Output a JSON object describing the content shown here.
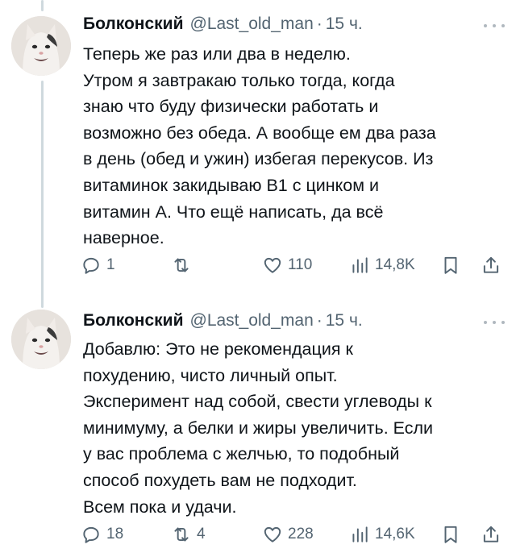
{
  "tweets": [
    {
      "author_name": "Болконский",
      "handle": "@Last_old_man",
      "separator": "·",
      "time": "15 ч.",
      "lines": [
        "Теперь же раз или два в неделю.",
        "Утром я завтракаю только тогда, когда",
        "знаю что буду физически работать и",
        "возможно без обеда. А вообще ем два раза",
        "в день (обед и ужин) избегая перекусов. Из",
        "витаминок закидываю B1 с цинком и",
        "витамин А. Что ещё написать, да всё",
        "наверное."
      ],
      "replies": "1",
      "retweets": "",
      "likes": "110",
      "views": "14,8K"
    },
    {
      "author_name": "Болконский",
      "handle": "@Last_old_man",
      "separator": "·",
      "time": "15 ч.",
      "lines": [
        "Добавлю: Это не рекомендация к",
        "похудению, чисто личный опыт.",
        "Эксперимент над собой, свести углеводы к",
        "минимуму, а белки и жиры увеличить. Если",
        "у вас проблема с желчью, то подобный",
        "способ похудеть вам не подходит.",
        "Всем пока и удачи."
      ],
      "replies": "18",
      "retweets": "4",
      "likes": "228",
      "views": "14,6K"
    }
  ],
  "icons": {
    "reply": "reply-icon",
    "retweet": "retweet-icon",
    "like": "heart-icon",
    "views": "views-icon",
    "bookmark": "bookmark-icon",
    "share": "share-icon",
    "more": "more-icon"
  },
  "colors": {
    "text": "#0f1419",
    "secondary": "#536471",
    "thread_line": "#cfd9de"
  }
}
